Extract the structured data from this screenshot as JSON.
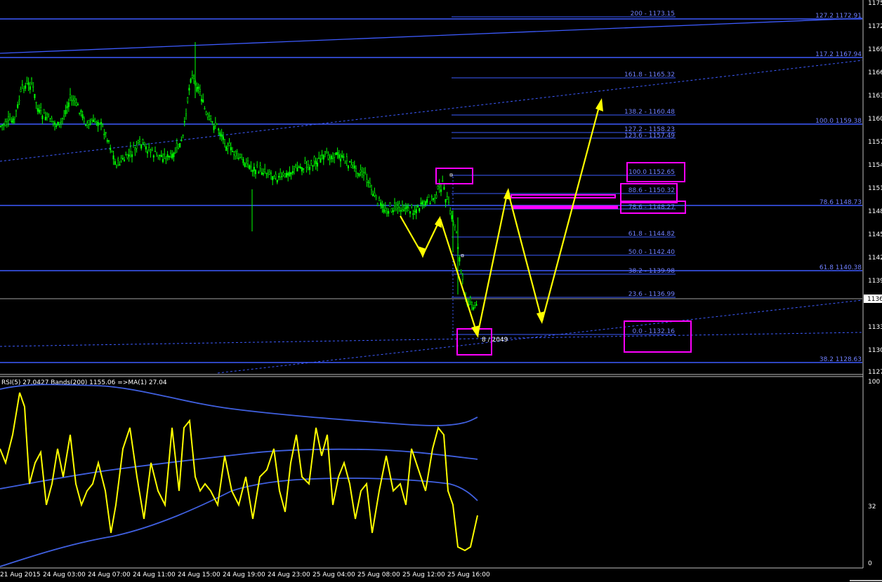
{
  "theme": {
    "background": "#000000",
    "frame": "#c0c0c0",
    "candle": "#00ff00",
    "fib_line": "#3d5bff",
    "fib_text": "#7080ff",
    "trend_dash": "#3d5bff",
    "arrow": "#ffff00",
    "highlight": "#ff00ff",
    "rsi_line": "#ffff00",
    "bands": "#4060e0",
    "axis_text": "#ffffff"
  },
  "price_axis": {
    "labels": [
      "1175",
      "1172",
      "1169",
      "1166",
      "1163",
      "1160",
      "1157",
      "1154",
      "1151",
      "1148",
      "1145",
      "1142",
      "1139",
      "1136",
      "1133",
      "1130",
      "1127"
    ],
    "current_price": "1136"
  },
  "fib_levels_left": [
    {
      "label": "200 - 1173.15"
    },
    {
      "label": "161.8 - 1165.32"
    },
    {
      "label": "138.2 - 1160.48"
    },
    {
      "label": "127.2 - 1158.23"
    },
    {
      "label": "123.6 - 1157.49"
    },
    {
      "label": "100.0  1152.65"
    },
    {
      "label": "88.6 - 1150.32"
    },
    {
      "label": "78.6 - 1148.27"
    },
    {
      "label": "61.8 - 1144.82"
    },
    {
      "label": "50.0 - 1142.40"
    },
    {
      "label": "38.2 - 1139.98"
    },
    {
      "label": "23.6 - 1136.99"
    },
    {
      "label": "0.0 - 1132.16"
    }
  ],
  "fib_levels_right": [
    {
      "label": "127.2  1172.91"
    },
    {
      "label": "117.2  1167.94"
    },
    {
      "label": "100.0   1159.38"
    },
    {
      "label": "78.6  1148.73"
    },
    {
      "label": "61.8  1140.38"
    },
    {
      "label": "38.2  1128.63"
    }
  ],
  "annotations": {
    "low_marker": "8 / 2049"
  },
  "rsi_panel": {
    "header": "RSI(5) 27.0427  Bands(200) 1155.06  =>MA(1) 27.04",
    "scale_labels": [
      "100",
      "32",
      "0"
    ]
  },
  "time_axis": {
    "labels": [
      "21 Aug 2015",
      "24 Aug 03:00",
      "24 Aug 07:00",
      "24 Aug 11:00",
      "24 Aug 15:00",
      "24 Aug 19:00",
      "24 Aug 23:00",
      "25 Aug 04:00",
      "25 Aug 08:00",
      "25 Aug 12:00",
      "25 Aug 16:00"
    ]
  }
}
